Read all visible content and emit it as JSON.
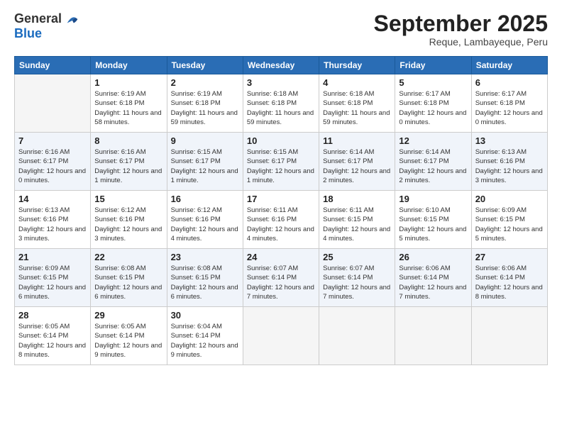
{
  "logo": {
    "general": "General",
    "blue": "Blue"
  },
  "header": {
    "month_title": "September 2025",
    "subtitle": "Reque, Lambayeque, Peru"
  },
  "weekdays": [
    "Sunday",
    "Monday",
    "Tuesday",
    "Wednesday",
    "Thursday",
    "Friday",
    "Saturday"
  ],
  "weeks": [
    [
      {
        "day": "",
        "empty": true
      },
      {
        "day": "1",
        "sunrise": "6:19 AM",
        "sunset": "6:18 PM",
        "daylight": "11 hours and 58 minutes."
      },
      {
        "day": "2",
        "sunrise": "6:19 AM",
        "sunset": "6:18 PM",
        "daylight": "11 hours and 59 minutes."
      },
      {
        "day": "3",
        "sunrise": "6:18 AM",
        "sunset": "6:18 PM",
        "daylight": "11 hours and 59 minutes."
      },
      {
        "day": "4",
        "sunrise": "6:18 AM",
        "sunset": "6:18 PM",
        "daylight": "11 hours and 59 minutes."
      },
      {
        "day": "5",
        "sunrise": "6:17 AM",
        "sunset": "6:18 PM",
        "daylight": "12 hours and 0 minutes."
      },
      {
        "day": "6",
        "sunrise": "6:17 AM",
        "sunset": "6:18 PM",
        "daylight": "12 hours and 0 minutes."
      }
    ],
    [
      {
        "day": "7",
        "sunrise": "6:16 AM",
        "sunset": "6:17 PM",
        "daylight": "12 hours and 0 minutes."
      },
      {
        "day": "8",
        "sunrise": "6:16 AM",
        "sunset": "6:17 PM",
        "daylight": "12 hours and 1 minute."
      },
      {
        "day": "9",
        "sunrise": "6:15 AM",
        "sunset": "6:17 PM",
        "daylight": "12 hours and 1 minute."
      },
      {
        "day": "10",
        "sunrise": "6:15 AM",
        "sunset": "6:17 PM",
        "daylight": "12 hours and 1 minute."
      },
      {
        "day": "11",
        "sunrise": "6:14 AM",
        "sunset": "6:17 PM",
        "daylight": "12 hours and 2 minutes."
      },
      {
        "day": "12",
        "sunrise": "6:14 AM",
        "sunset": "6:17 PM",
        "daylight": "12 hours and 2 minutes."
      },
      {
        "day": "13",
        "sunrise": "6:13 AM",
        "sunset": "6:16 PM",
        "daylight": "12 hours and 3 minutes."
      }
    ],
    [
      {
        "day": "14",
        "sunrise": "6:13 AM",
        "sunset": "6:16 PM",
        "daylight": "12 hours and 3 minutes."
      },
      {
        "day": "15",
        "sunrise": "6:12 AM",
        "sunset": "6:16 PM",
        "daylight": "12 hours and 3 minutes."
      },
      {
        "day": "16",
        "sunrise": "6:12 AM",
        "sunset": "6:16 PM",
        "daylight": "12 hours and 4 minutes."
      },
      {
        "day": "17",
        "sunrise": "6:11 AM",
        "sunset": "6:16 PM",
        "daylight": "12 hours and 4 minutes."
      },
      {
        "day": "18",
        "sunrise": "6:11 AM",
        "sunset": "6:15 PM",
        "daylight": "12 hours and 4 minutes."
      },
      {
        "day": "19",
        "sunrise": "6:10 AM",
        "sunset": "6:15 PM",
        "daylight": "12 hours and 5 minutes."
      },
      {
        "day": "20",
        "sunrise": "6:09 AM",
        "sunset": "6:15 PM",
        "daylight": "12 hours and 5 minutes."
      }
    ],
    [
      {
        "day": "21",
        "sunrise": "6:09 AM",
        "sunset": "6:15 PM",
        "daylight": "12 hours and 6 minutes."
      },
      {
        "day": "22",
        "sunrise": "6:08 AM",
        "sunset": "6:15 PM",
        "daylight": "12 hours and 6 minutes."
      },
      {
        "day": "23",
        "sunrise": "6:08 AM",
        "sunset": "6:15 PM",
        "daylight": "12 hours and 6 minutes."
      },
      {
        "day": "24",
        "sunrise": "6:07 AM",
        "sunset": "6:14 PM",
        "daylight": "12 hours and 7 minutes."
      },
      {
        "day": "25",
        "sunrise": "6:07 AM",
        "sunset": "6:14 PM",
        "daylight": "12 hours and 7 minutes."
      },
      {
        "day": "26",
        "sunrise": "6:06 AM",
        "sunset": "6:14 PM",
        "daylight": "12 hours and 7 minutes."
      },
      {
        "day": "27",
        "sunrise": "6:06 AM",
        "sunset": "6:14 PM",
        "daylight": "12 hours and 8 minutes."
      }
    ],
    [
      {
        "day": "28",
        "sunrise": "6:05 AM",
        "sunset": "6:14 PM",
        "daylight": "12 hours and 8 minutes."
      },
      {
        "day": "29",
        "sunrise": "6:05 AM",
        "sunset": "6:14 PM",
        "daylight": "12 hours and 9 minutes."
      },
      {
        "day": "30",
        "sunrise": "6:04 AM",
        "sunset": "6:14 PM",
        "daylight": "12 hours and 9 minutes."
      },
      {
        "day": "",
        "empty": true
      },
      {
        "day": "",
        "empty": true
      },
      {
        "day": "",
        "empty": true
      },
      {
        "day": "",
        "empty": true
      }
    ]
  ]
}
